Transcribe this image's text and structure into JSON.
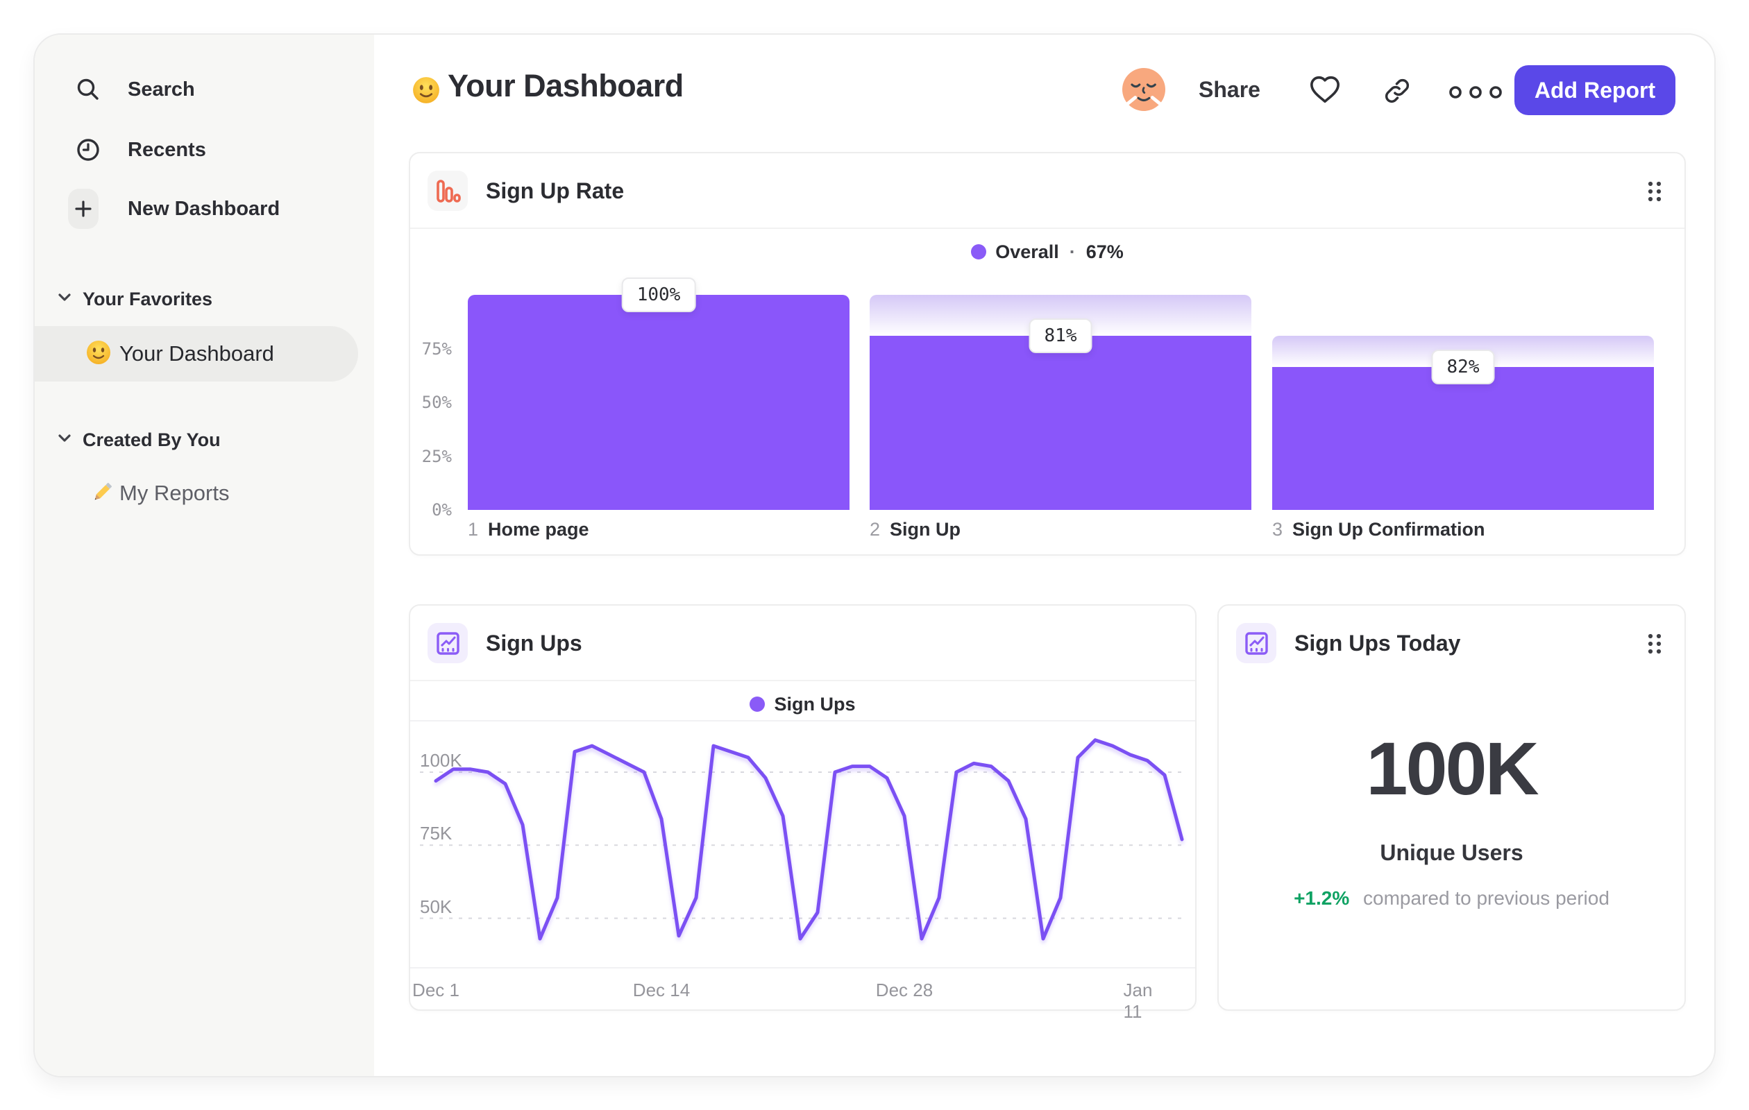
{
  "sidebar": {
    "nav": [
      {
        "label": "Search",
        "icon": "search-icon"
      },
      {
        "label": "Recents",
        "icon": "clock-icon"
      },
      {
        "label": "New Dashboard",
        "icon": "plus-icon"
      }
    ],
    "sections": [
      {
        "title": "Your Favorites",
        "items": [
          {
            "label": "Your Dashboard",
            "icon": "smiley-emoji",
            "selected": true
          }
        ]
      },
      {
        "title": "Created By You",
        "items": [
          {
            "label": "My Reports",
            "icon": "pencil-emoji",
            "selected": false
          }
        ]
      }
    ]
  },
  "header": {
    "emoji": "smiley-emoji",
    "title": "Your Dashboard",
    "share_label": "Share",
    "add_report_label": "Add Report"
  },
  "colors": {
    "bar_purple": "#8A56FA",
    "bar_gradient_top": "#D5C8F7",
    "line_purple": "#7B50F3",
    "legend_dot": "#8A5BF7",
    "button_purple": "#5A48E8",
    "delta_green": "#0FA263",
    "funnel_icon_orange": "#EE6A52",
    "chart_icon_purple": "#8B5CF6"
  },
  "chart_data": [
    {
      "type": "bar",
      "variant": "funnel",
      "title": "Sign Up Rate",
      "legend": {
        "name": "Overall",
        "separator": "·",
        "value": "67%"
      },
      "ylim": [
        0,
        100
      ],
      "yticks": [
        {
          "label": "75%",
          "value": 75
        },
        {
          "label": "50%",
          "value": 50
        },
        {
          "label": "25%",
          "value": 25
        },
        {
          "label": "0%",
          "value": 0
        }
      ],
      "steps": [
        {
          "index": "1",
          "name": "Home page",
          "label": "100%",
          "conversion_from_previous_pct": 100,
          "absolute_pct": 100
        },
        {
          "index": "2",
          "name": "Sign Up",
          "label": "81%",
          "conversion_from_previous_pct": 81,
          "absolute_pct": 81
        },
        {
          "index": "3",
          "name": "Sign Up Confirmation",
          "label": "82%",
          "conversion_from_previous_pct": 82,
          "absolute_pct": 66.4
        }
      ]
    },
    {
      "type": "line",
      "title": "Sign Ups",
      "legend": {
        "name": "Sign Ups"
      },
      "unit": "K",
      "values": [
        97,
        101,
        101,
        100,
        96,
        82,
        43,
        57,
        107,
        109,
        106,
        103,
        100,
        84,
        44,
        57,
        109,
        107,
        105,
        98,
        85,
        43,
        52,
        100,
        102,
        102,
        98,
        85,
        43,
        57,
        100,
        103,
        102,
        97,
        84,
        43,
        57,
        105,
        111,
        109,
        106,
        104,
        99,
        77
      ],
      "xticks": [
        {
          "label": "Dec 1",
          "day": 0
        },
        {
          "label": "Dec 14",
          "day": 13
        },
        {
          "label": "Dec 28",
          "day": 27
        },
        {
          "label": "Jan 11",
          "day": 41
        }
      ],
      "yticks": [
        {
          "label": "100K",
          "value": 100
        },
        {
          "label": "75K",
          "value": 75
        },
        {
          "label": "50K",
          "value": 50
        }
      ],
      "ylim": [
        33,
        117
      ],
      "grid": "dashed"
    },
    {
      "type": "metric",
      "title": "Sign Ups Today",
      "value": "100K",
      "label": "Unique Users",
      "delta": "+1.2%",
      "delta_note": "compared to previous period"
    }
  ]
}
